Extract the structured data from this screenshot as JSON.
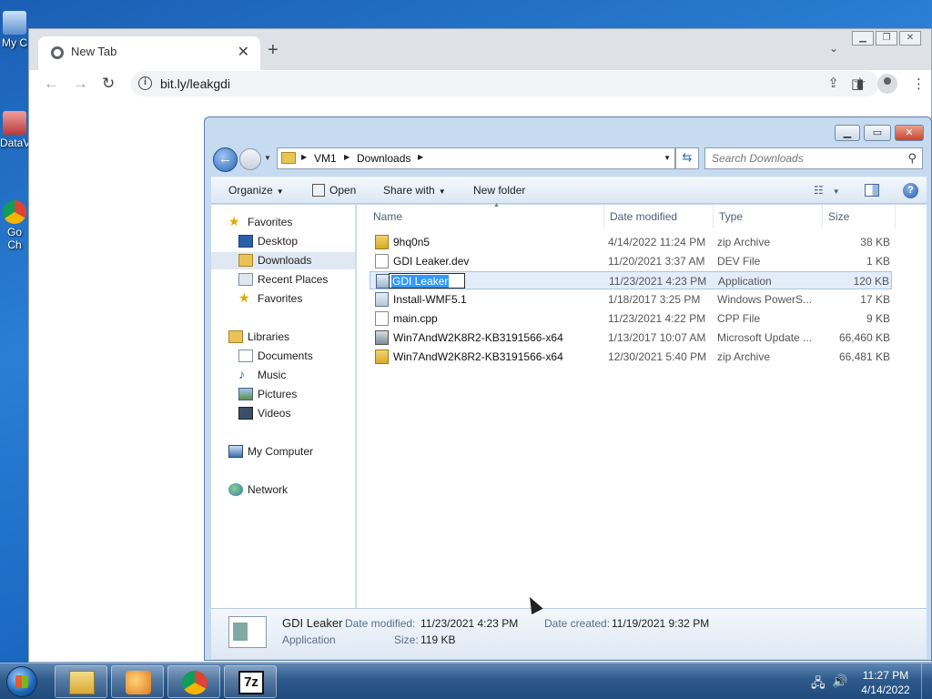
{
  "desktop": {
    "icons": [
      {
        "label": "My C"
      },
      {
        "label": "DataV"
      },
      {
        "label": "Go Ch"
      }
    ]
  },
  "chrome": {
    "tab_title": "New Tab",
    "url": "bit.ly/leakgdi",
    "buttons": {
      "new_tab": "+",
      "close_tab": "✕",
      "back": "←",
      "forward": "→",
      "reload": "↻",
      "menu": "⋮",
      "tab_search": "⌄"
    }
  },
  "explorer": {
    "breadcrumb": [
      "VM1",
      "Downloads"
    ],
    "search_placeholder": "Search Downloads",
    "commands": {
      "organize": "Organize",
      "open": "Open",
      "share_with": "Share with",
      "new_folder": "New folder"
    },
    "nav": [
      {
        "label": "Favorites",
        "icon": "star-icon",
        "section": true
      },
      {
        "label": "Desktop",
        "icon": "desktop-icon"
      },
      {
        "label": "Downloads",
        "icon": "downloads-folder-icon",
        "selected": true
      },
      {
        "label": "Recent Places",
        "icon": "recent-places-icon"
      },
      {
        "label": "Favorites",
        "icon": "star-icon"
      },
      {
        "label": "Libraries",
        "icon": "libraries-icon",
        "section": true
      },
      {
        "label": "Documents",
        "icon": "documents-icon"
      },
      {
        "label": "Music",
        "icon": "music-icon"
      },
      {
        "label": "Pictures",
        "icon": "pictures-icon"
      },
      {
        "label": "Videos",
        "icon": "videos-icon"
      },
      {
        "label": "My Computer",
        "icon": "computer-icon",
        "section": true
      },
      {
        "label": "Network",
        "icon": "network-icon",
        "section": true
      }
    ],
    "columns": {
      "name": "Name",
      "date": "Date modified",
      "type": "Type",
      "size": "Size"
    },
    "files": [
      {
        "name": "9hq0n5",
        "date": "4/14/2022 11:24 PM",
        "type": "zip Archive",
        "size": "38 KB",
        "icon": "zip"
      },
      {
        "name": "GDI Leaker.dev",
        "date": "11/20/2021 3:37 AM",
        "type": "DEV File",
        "size": "1 KB",
        "icon": "file"
      },
      {
        "name": "GDI Leaker",
        "date": "11/23/2021 4:23 PM",
        "type": "Application",
        "size": "120 KB",
        "icon": "app",
        "selected": true,
        "renaming": true
      },
      {
        "name": "Install-WMF5.1",
        "date": "1/18/2017 3:25 PM",
        "type": "Windows PowerS...",
        "size": "17 KB",
        "icon": "ps"
      },
      {
        "name": "main.cpp",
        "date": "11/23/2021 4:22 PM",
        "type": "CPP File",
        "size": "9 KB",
        "icon": "file"
      },
      {
        "name": "Win7AndW2K8R2-KB3191566-x64",
        "date": "1/13/2017 10:07 AM",
        "type": "Microsoft Update ...",
        "size": "66,460 KB",
        "icon": "msu"
      },
      {
        "name": "Win7AndW2K8R2-KB3191566-x64",
        "date": "12/30/2021 5:40 PM",
        "type": "zip Archive",
        "size": "66,481 KB",
        "icon": "zip"
      }
    ],
    "details": {
      "name": "GDI Leaker",
      "kind": "Application",
      "date_modified_label": "Date modified:",
      "date_modified": "11/23/2021 4:23 PM",
      "date_created_label": "Date created:",
      "date_created": "11/19/2021 9:32 PM",
      "size_label": "Size:",
      "size": "119 KB"
    }
  },
  "taskbar": {
    "clock_time": "11:27 PM",
    "clock_date": "4/14/2022",
    "apps": [
      "explorer-icon",
      "media-player-icon",
      "chrome-icon",
      "7zip-icon"
    ],
    "sevenzip_label": "7z"
  }
}
